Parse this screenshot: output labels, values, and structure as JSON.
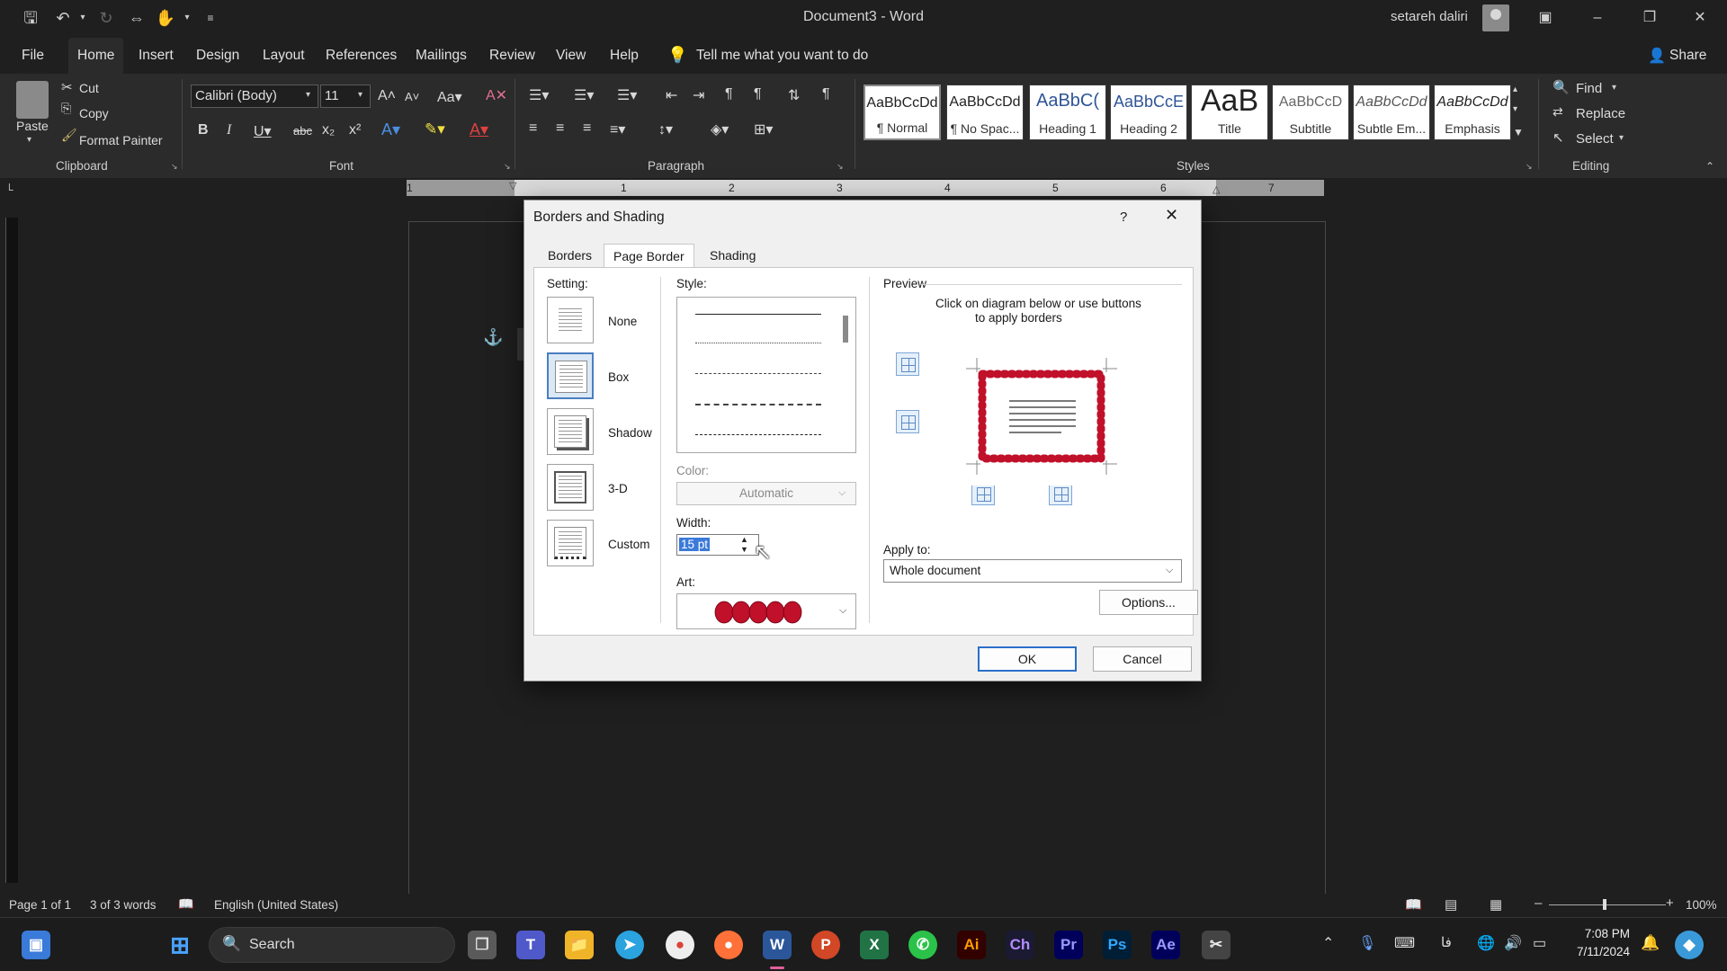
{
  "window": {
    "title": "Document3  -  Word",
    "user": "setareh daliri"
  },
  "menu": {
    "tabs": [
      "File",
      "Home",
      "Insert",
      "Design",
      "Layout",
      "References",
      "Mailings",
      "Review",
      "View",
      "Help"
    ],
    "tell_me": "Tell me what you want to do",
    "share": "Share"
  },
  "ribbon": {
    "clipboard": {
      "paste": "Paste",
      "cut": "Cut",
      "copy": "Copy",
      "format_painter": "Format Painter",
      "label": "Clipboard"
    },
    "font": {
      "family": "Calibri (Body)",
      "size": "11",
      "label": "Font"
    },
    "paragraph": {
      "label": "Paragraph"
    },
    "styles": {
      "label": "Styles",
      "items": [
        {
          "sample": "AaBbCcDd",
          "name": "¶ Normal"
        },
        {
          "sample": "AaBbCcDd",
          "name": "¶ No Spac..."
        },
        {
          "sample": "AaBbC(",
          "name": "Heading 1"
        },
        {
          "sample": "AaBbCcE",
          "name": "Heading 2"
        },
        {
          "sample": "AaB",
          "name": "Title"
        },
        {
          "sample": "AaBbCcD",
          "name": "Subtitle"
        },
        {
          "sample": "AaBbCcDd",
          "name": "Subtle Em..."
        },
        {
          "sample": "AaBbCcDd",
          "name": "Emphasis"
        }
      ]
    },
    "editing": {
      "find": "Find",
      "replace": "Replace",
      "select": "Select",
      "label": "Editing"
    }
  },
  "ruler": {
    "numbers": [
      "1",
      "1",
      "2",
      "3",
      "4",
      "5",
      "6",
      "7"
    ]
  },
  "dialog": {
    "title": "Borders and Shading",
    "help": "?",
    "tabs": [
      "Borders",
      "Page Border",
      "Shading"
    ],
    "setting": {
      "label": "Setting:",
      "options": [
        "None",
        "Box",
        "Shadow",
        "3-D",
        "Custom"
      ]
    },
    "style_label": "Style:",
    "color_label": "Color:",
    "color_value": "Automatic",
    "width_label": "Width:",
    "width_value": "15 pt",
    "art_label": "Art:",
    "preview": {
      "label": "Preview",
      "hint_line1": "Click on diagram below or use buttons",
      "hint_line2": "to apply borders"
    },
    "apply_to_label": "Apply to:",
    "apply_to_value": "Whole document",
    "options_button": "Options...",
    "ok": "OK",
    "cancel": "Cancel"
  },
  "status": {
    "page": "Page 1 of 1",
    "words": "3 of 3 words",
    "language": "English (United States)",
    "zoom": "100%"
  },
  "taskbar": {
    "search_placeholder": "Search",
    "time": "7:08 PM",
    "date": "7/11/2024",
    "lang": "فا"
  }
}
